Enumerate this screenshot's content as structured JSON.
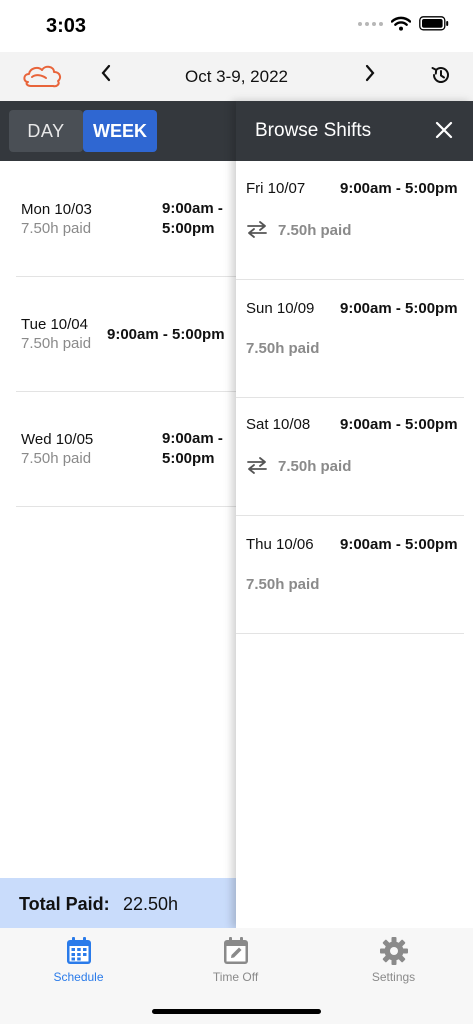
{
  "status_bar": {
    "time": "3:03"
  },
  "nav": {
    "week_title": "Oct 3-9, 2022"
  },
  "view_toggle": {
    "day": "DAY",
    "week": "WEEK"
  },
  "schedule": [
    {
      "date": "Mon 10/03",
      "time": "9:00am - 5:00pm",
      "paid": "7.50h paid"
    },
    {
      "date": "Tue 10/04",
      "time": "9:00am - 5:00pm",
      "paid": "7.50h paid"
    },
    {
      "date": "Wed 10/05",
      "time": "9:00am - 5:00pm",
      "paid": "7.50h paid"
    }
  ],
  "total": {
    "label": "Total Paid:",
    "value": "22.50h"
  },
  "browse_panel": {
    "title": "Browse Shifts",
    "shifts": [
      {
        "date": "Fri 10/07",
        "time": "9:00am - 5:00pm",
        "paid": "7.50h paid",
        "swap": true
      },
      {
        "date": "Sun 10/09",
        "time": "9:00am - 5:00pm",
        "paid": "7.50h paid",
        "swap": false
      },
      {
        "date": "Sat 10/08",
        "time": "9:00am - 5:00pm",
        "paid": "7.50h paid",
        "swap": true
      },
      {
        "date": "Thu 10/06",
        "time": "9:00am - 5:00pm",
        "paid": "7.50h paid",
        "swap": false
      }
    ]
  },
  "tabs": [
    {
      "label": "Schedule",
      "icon": "calendar-icon",
      "active": true
    },
    {
      "label": "Time Off",
      "icon": "calendar-edit-icon",
      "active": false
    },
    {
      "label": "Settings",
      "icon": "gear-icon",
      "active": false
    }
  ],
  "colors": {
    "accent": "#2f67d2",
    "dark_bar": "#34383d",
    "total_bg": "#c9dcfb",
    "logo": "#e8643a",
    "tab_active": "#2a7bea",
    "tab_inactive": "#8a8a8a"
  }
}
